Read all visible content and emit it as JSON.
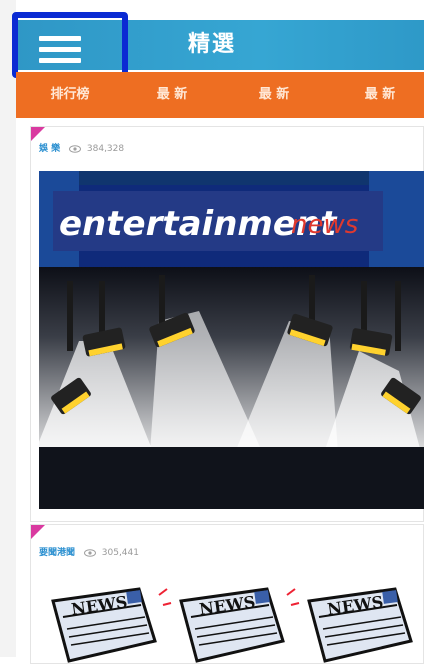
{
  "header": {
    "title": "精選"
  },
  "tabs": [
    "排行榜",
    "最 新",
    "最 新",
    "最 新"
  ],
  "cards": [
    {
      "category": "娛 樂",
      "views": "384,328",
      "banner_text_main": "entertainment",
      "banner_text_accent": "news"
    },
    {
      "category": "要聞港聞",
      "views": "305,441",
      "paper_label": "NEWS"
    }
  ],
  "colors": {
    "header": "#36a6d3",
    "tabs": "#ee6e22",
    "highlight": "#0b2bd3",
    "category": "#2a8fd0",
    "corner": "#d93aa0"
  }
}
